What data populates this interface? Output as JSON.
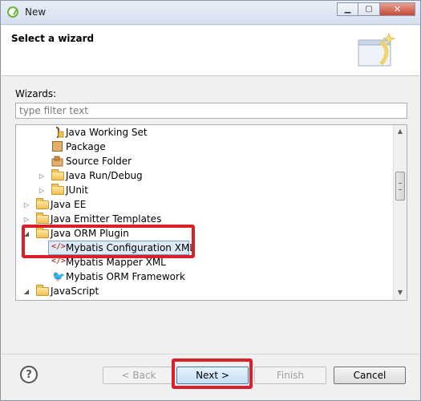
{
  "window": {
    "title": "New"
  },
  "header": {
    "title": "Select a wizard"
  },
  "filter": {
    "label": "Wizards:",
    "placeholder": "type filter text"
  },
  "tree": {
    "items": [
      {
        "label": "Java Working Set",
        "icon": "working-set-icon",
        "expanded": null
      },
      {
        "label": "Package",
        "icon": "package-icon",
        "expanded": null
      },
      {
        "label": "Source Folder",
        "icon": "source-folder-icon",
        "expanded": null
      },
      {
        "label": "Java Run/Debug",
        "icon": "folder-icon",
        "expanded": false
      },
      {
        "label": "JUnit",
        "icon": "folder-icon",
        "expanded": false
      },
      {
        "label": "Java EE",
        "icon": "folder-icon",
        "expanded": false
      },
      {
        "label": "Java Emitter Templates",
        "icon": "folder-icon",
        "expanded": false
      },
      {
        "label": "Java ORM Plugin",
        "icon": "folder-icon",
        "expanded": true
      },
      {
        "label": "Mybatis Configuration XML",
        "icon": "xml-file-icon",
        "expanded": null,
        "selected": true
      },
      {
        "label": "Mybatis Mapper XML",
        "icon": "xml-file-icon",
        "expanded": null
      },
      {
        "label": "Mybatis ORM Framework",
        "icon": "mybatis-bird-icon",
        "expanded": null
      },
      {
        "label": "JavaScript",
        "icon": "folder-icon",
        "expanded": true
      }
    ]
  },
  "buttons": {
    "back": "< Back",
    "next": "Next >",
    "finish": "Finish",
    "cancel": "Cancel",
    "help": "?"
  },
  "colors": {
    "highlight": "#d9202a",
    "selection": "#dfeaf8"
  }
}
